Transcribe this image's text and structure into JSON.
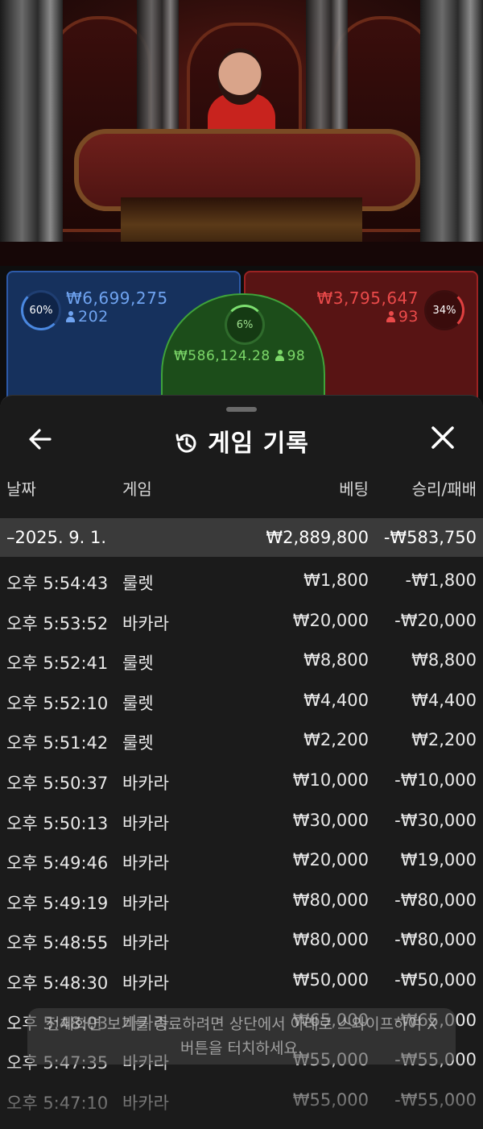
{
  "bets": {
    "player": {
      "percent": "60%",
      "amount": "₩6,699,275",
      "count": "202",
      "color": "#6fa3f0"
    },
    "tie": {
      "percent": "6%",
      "amount": "₩586,124.28",
      "count": "98",
      "color": "#7cd869"
    },
    "banker": {
      "percent": "34%",
      "amount": "₩3,795,647",
      "count": "93",
      "color": "#ea4a4a"
    }
  },
  "history": {
    "title": "게임 기록",
    "columns": {
      "date": "날짜",
      "game": "게임",
      "bet": "베팅",
      "result": "승리/패배"
    },
    "summary": {
      "date": "–2025. 9. 1.",
      "bet": "₩2,889,800",
      "result": "-₩583,750"
    },
    "rows": [
      {
        "time": "오후 5:54:43",
        "game": "룰렛",
        "bet": "₩1,800",
        "result": "-₩1,800"
      },
      {
        "time": "오후 5:53:52",
        "game": "바카라",
        "bet": "₩20,000",
        "result": "-₩20,000"
      },
      {
        "time": "오후 5:52:41",
        "game": "룰렛",
        "bet": "₩8,800",
        "result": "₩8,800"
      },
      {
        "time": "오후 5:52:10",
        "game": "룰렛",
        "bet": "₩4,400",
        "result": "₩4,400"
      },
      {
        "time": "오후 5:51:42",
        "game": "룰렛",
        "bet": "₩2,200",
        "result": "₩2,200"
      },
      {
        "time": "오후 5:50:37",
        "game": "바카라",
        "bet": "₩10,000",
        "result": "-₩10,000"
      },
      {
        "time": "오후 5:50:13",
        "game": "바카라",
        "bet": "₩30,000",
        "result": "-₩30,000"
      },
      {
        "time": "오후 5:49:46",
        "game": "바카라",
        "bet": "₩20,000",
        "result": "₩19,000"
      },
      {
        "time": "오후 5:49:19",
        "game": "바카라",
        "bet": "₩80,000",
        "result": "-₩80,000"
      },
      {
        "time": "오후 5:48:55",
        "game": "바카라",
        "bet": "₩80,000",
        "result": "-₩80,000"
      },
      {
        "time": "오후 5:48:30",
        "game": "바카라",
        "bet": "₩50,000",
        "result": "-₩50,000"
      },
      {
        "time": "오후 5:48:03",
        "game": "바카라",
        "bet": "₩65,000",
        "result": "-₩65,000"
      },
      {
        "time": "오후 5:47:35",
        "game": "바카라",
        "bet": "₩55,000",
        "result": "-₩55,000"
      },
      {
        "time": "오후 5:47:10",
        "game": "바카라",
        "bet": "₩55,000",
        "result": "-₩55,000"
      }
    ]
  },
  "toast": {
    "line1": "전체화면 보기를 종료하려면 상단에서 아래로 스와이프하여 X",
    "line2": "버튼을 터치하세요."
  },
  "icons": {
    "back": "arrow-left-icon",
    "history": "history-icon",
    "close": "close-icon",
    "person": "person-icon"
  }
}
